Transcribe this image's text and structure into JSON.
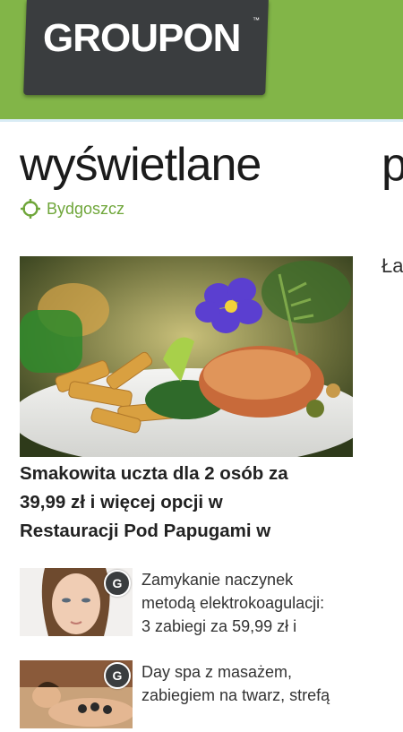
{
  "header": {
    "logo_text": "GROUPON",
    "trademark": "™",
    "bg_color": "#82b548"
  },
  "pivot": {
    "title": "wyświetlane",
    "next_title_partial": "p",
    "side_text_partial": "Ła"
  },
  "location": {
    "icon": "crosshair-location-icon",
    "city": "Bydgoszcz",
    "color": "#6fa63a"
  },
  "featured_deal": {
    "image": "food-plate-image",
    "title_lines": [
      "Smakowita uczta dla 2 osób za",
      "39,99 zł i więcej opcji w",
      "Restauracji Pod Papugami w"
    ]
  },
  "deal_list": [
    {
      "thumbnail": "woman-face-image",
      "badge": "G",
      "lines": [
        "Zamykanie naczynek",
        "metodą elektrokoagulacji:",
        "3 zabiegi za 59,99 zł i"
      ]
    },
    {
      "thumbnail": "spa-massage-image",
      "badge": "G",
      "lines": [
        "Day spa z masażem,",
        "zabiegiem na twarz, strefą"
      ]
    }
  ]
}
